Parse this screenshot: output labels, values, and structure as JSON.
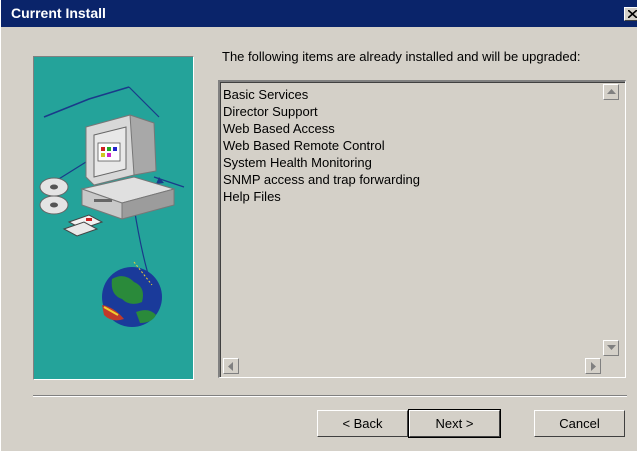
{
  "window": {
    "title": "Current Install"
  },
  "content": {
    "intro": "The following items are already installed and will be upgraded:",
    "items": [
      "Basic Services",
      "Director Support",
      "Web Based Access",
      "Web Based Remote Control",
      "System Health Monitoring",
      "SNMP access and trap forwarding",
      "Help Files"
    ]
  },
  "buttons": {
    "back": "< Back",
    "next": "Next >",
    "cancel": "Cancel"
  },
  "colors": {
    "title_bar": "#0a246a",
    "face": "#d4d0c8",
    "art_background": "#24a39a"
  },
  "icons": {
    "close": "close-icon",
    "art": "computer-globe-illustration"
  }
}
